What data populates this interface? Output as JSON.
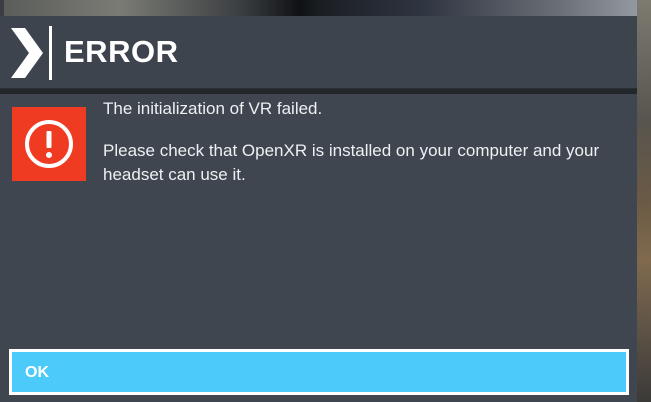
{
  "dialog": {
    "title": "ERROR",
    "message_line1": "The initialization of VR failed.",
    "message_line2": "Please check that OpenXR is installed on your computer and your headset can use it.",
    "ok_label": "OK",
    "icon": "exclamation-circle-icon",
    "header_icon": "chevron-right-icon"
  },
  "colors": {
    "header_bg": "#3d444d",
    "body_bg": "#3f4650",
    "error_red": "#ef3b22",
    "button_blue": "#4ccbfa",
    "text": "#ffffff"
  }
}
